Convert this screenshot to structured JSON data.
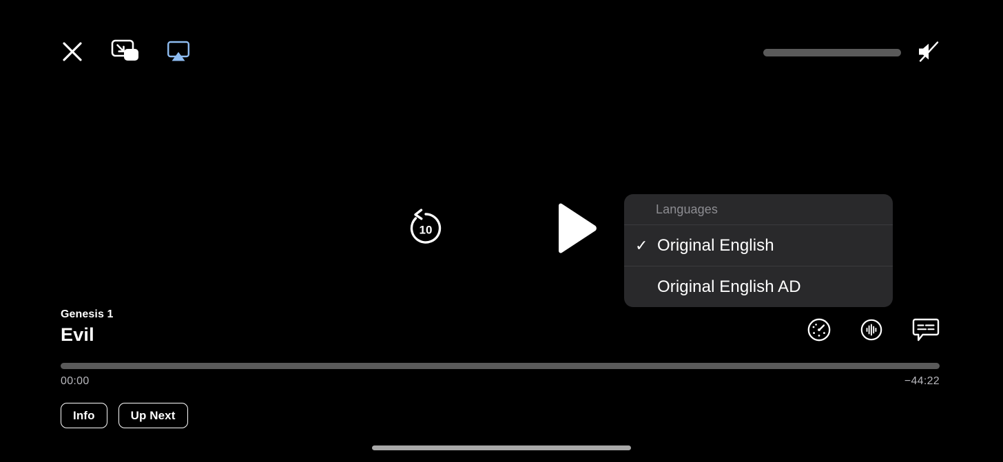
{
  "app": {
    "name": "video-player",
    "background_color": "#000000"
  },
  "top_bar": {
    "close_button": {
      "icon": "close-x-icon",
      "label": "Close"
    },
    "pip_button": {
      "icon": "picture-in-picture-icon",
      "label": "Picture in Picture"
    },
    "airplay_button": {
      "icon": "airplay-icon",
      "label": "AirPlay",
      "color": "#8fbdf2",
      "active": true
    },
    "volume": {
      "icon": "speaker-mute-icon",
      "label": "Volume",
      "value_percent": 0,
      "muted": true,
      "track_color": "#5a5a5a",
      "fill_color": "#e8e8e8"
    }
  },
  "center_controls": {
    "skip_back": {
      "icon": "skip-back-10-icon",
      "label": "10",
      "seconds": 10
    },
    "play": {
      "icon": "play-icon",
      "label": "Play",
      "state": "paused"
    }
  },
  "languages_popup": {
    "header": "Languages",
    "background_color": "#29292b",
    "items": [
      {
        "label": "Original English",
        "selected": true,
        "check": "✓"
      },
      {
        "label": "Original English AD",
        "selected": false,
        "check": "✓"
      }
    ]
  },
  "now_playing": {
    "series": "Genesis 1",
    "title": "Evil"
  },
  "bottom_icons": [
    {
      "name": "playback-speed-icon",
      "label": "Playback Speed"
    },
    {
      "name": "audio-waveform-icon",
      "label": "Audio"
    },
    {
      "name": "subtitles-icon",
      "label": "Subtitles"
    }
  ],
  "scrubber": {
    "progress_percent": 0,
    "elapsed": "00:00",
    "remaining": "−44:22",
    "track_color": "#5a5a5a",
    "fill_color": "#ffffff"
  },
  "chips": [
    {
      "label": "Info"
    },
    {
      "label": "Up Next"
    }
  ],
  "home_indicator": {
    "color": "#a8a8a8"
  }
}
